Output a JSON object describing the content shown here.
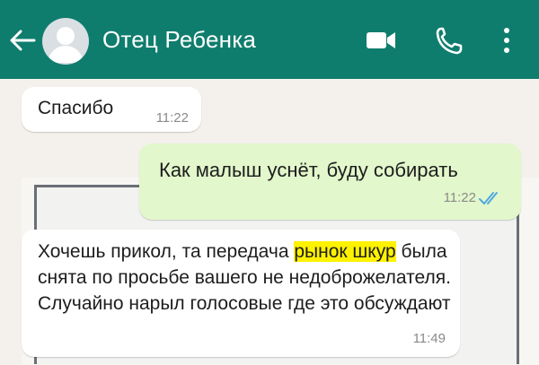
{
  "header": {
    "contact_name": "Отец Ребенка",
    "background_color": "#0f7d6d",
    "icons": [
      "back-arrow-icon",
      "avatar-placeholder",
      "video-call-icon",
      "phone-call-icon",
      "more-vert-icon"
    ]
  },
  "messages": [
    {
      "direction": "incoming",
      "text": "Спасибо",
      "time": "11:22"
    },
    {
      "direction": "outgoing",
      "text": "Как малыш уснёт, буду собирать",
      "time": "11:22",
      "status": "read"
    },
    {
      "direction": "incoming",
      "text_parts": [
        "Хочешь прикол, та передача ",
        "рынок шкур",
        " была  снята по просьбе вашего не недоброжелателя. Случайно нарыл голосовые где это обсуждают"
      ],
      "time": "11:49",
      "highlight_color": "#fff200"
    }
  ]
}
